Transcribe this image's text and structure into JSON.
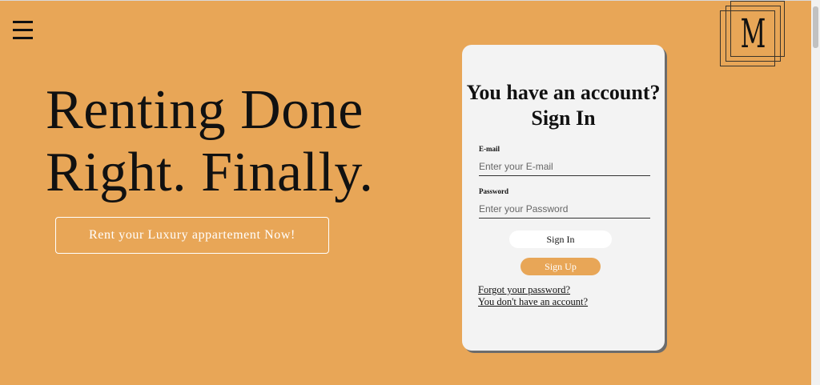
{
  "header": {
    "menu_icon": "hamburger-menu-icon",
    "logo_letter": "M"
  },
  "hero": {
    "title_line1": "Renting Done",
    "title_line2": "Right. Finally.",
    "cta_label": "Rent your Luxury appartement Now!"
  },
  "login": {
    "title": "You have an account? Sign In",
    "email_label": "E-mail",
    "email_placeholder": "Enter your E-mail",
    "email_value": "",
    "password_label": "Password",
    "password_placeholder": "Enter your Password",
    "password_value": "",
    "signin_label": "Sign In",
    "signup_label": "Sign Up",
    "forgot_link": "Forgot your password?",
    "no_account_link": "You don't have an account?"
  },
  "colors": {
    "background": "#e8a657",
    "card": "#f3f3f3",
    "accent": "#e8a657"
  }
}
